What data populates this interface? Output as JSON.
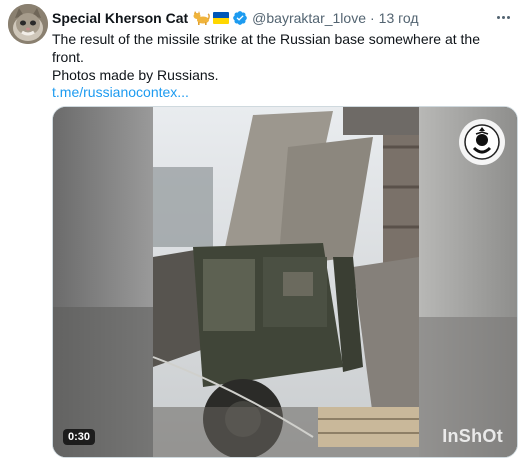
{
  "author": {
    "display_name": "Special Kherson Cat",
    "handle": "@bayraktar_1love",
    "separator": "·",
    "time": "13 год",
    "avatar_icon": "cat-avatar-icon",
    "badges": [
      "cat-emoji-icon",
      "ukraine-flag-icon",
      "verified-badge-icon"
    ],
    "verified_color": "#1d9bf0"
  },
  "tweet": {
    "text_line1": "The result of the missile strike at the Russian base somewhere at the front.",
    "text_line2": "Photos made by Russians.",
    "link": "t.me/russianocontex..."
  },
  "media": {
    "type": "video",
    "duration": "0:30",
    "watermark": "InShOt",
    "overlay_icon": "channel-logo-icon"
  },
  "menu": {
    "more_icon": "more-options-icon"
  },
  "colors": {
    "link": "#1d9bf0",
    "muted": "#536471",
    "text": "#0f1419"
  }
}
